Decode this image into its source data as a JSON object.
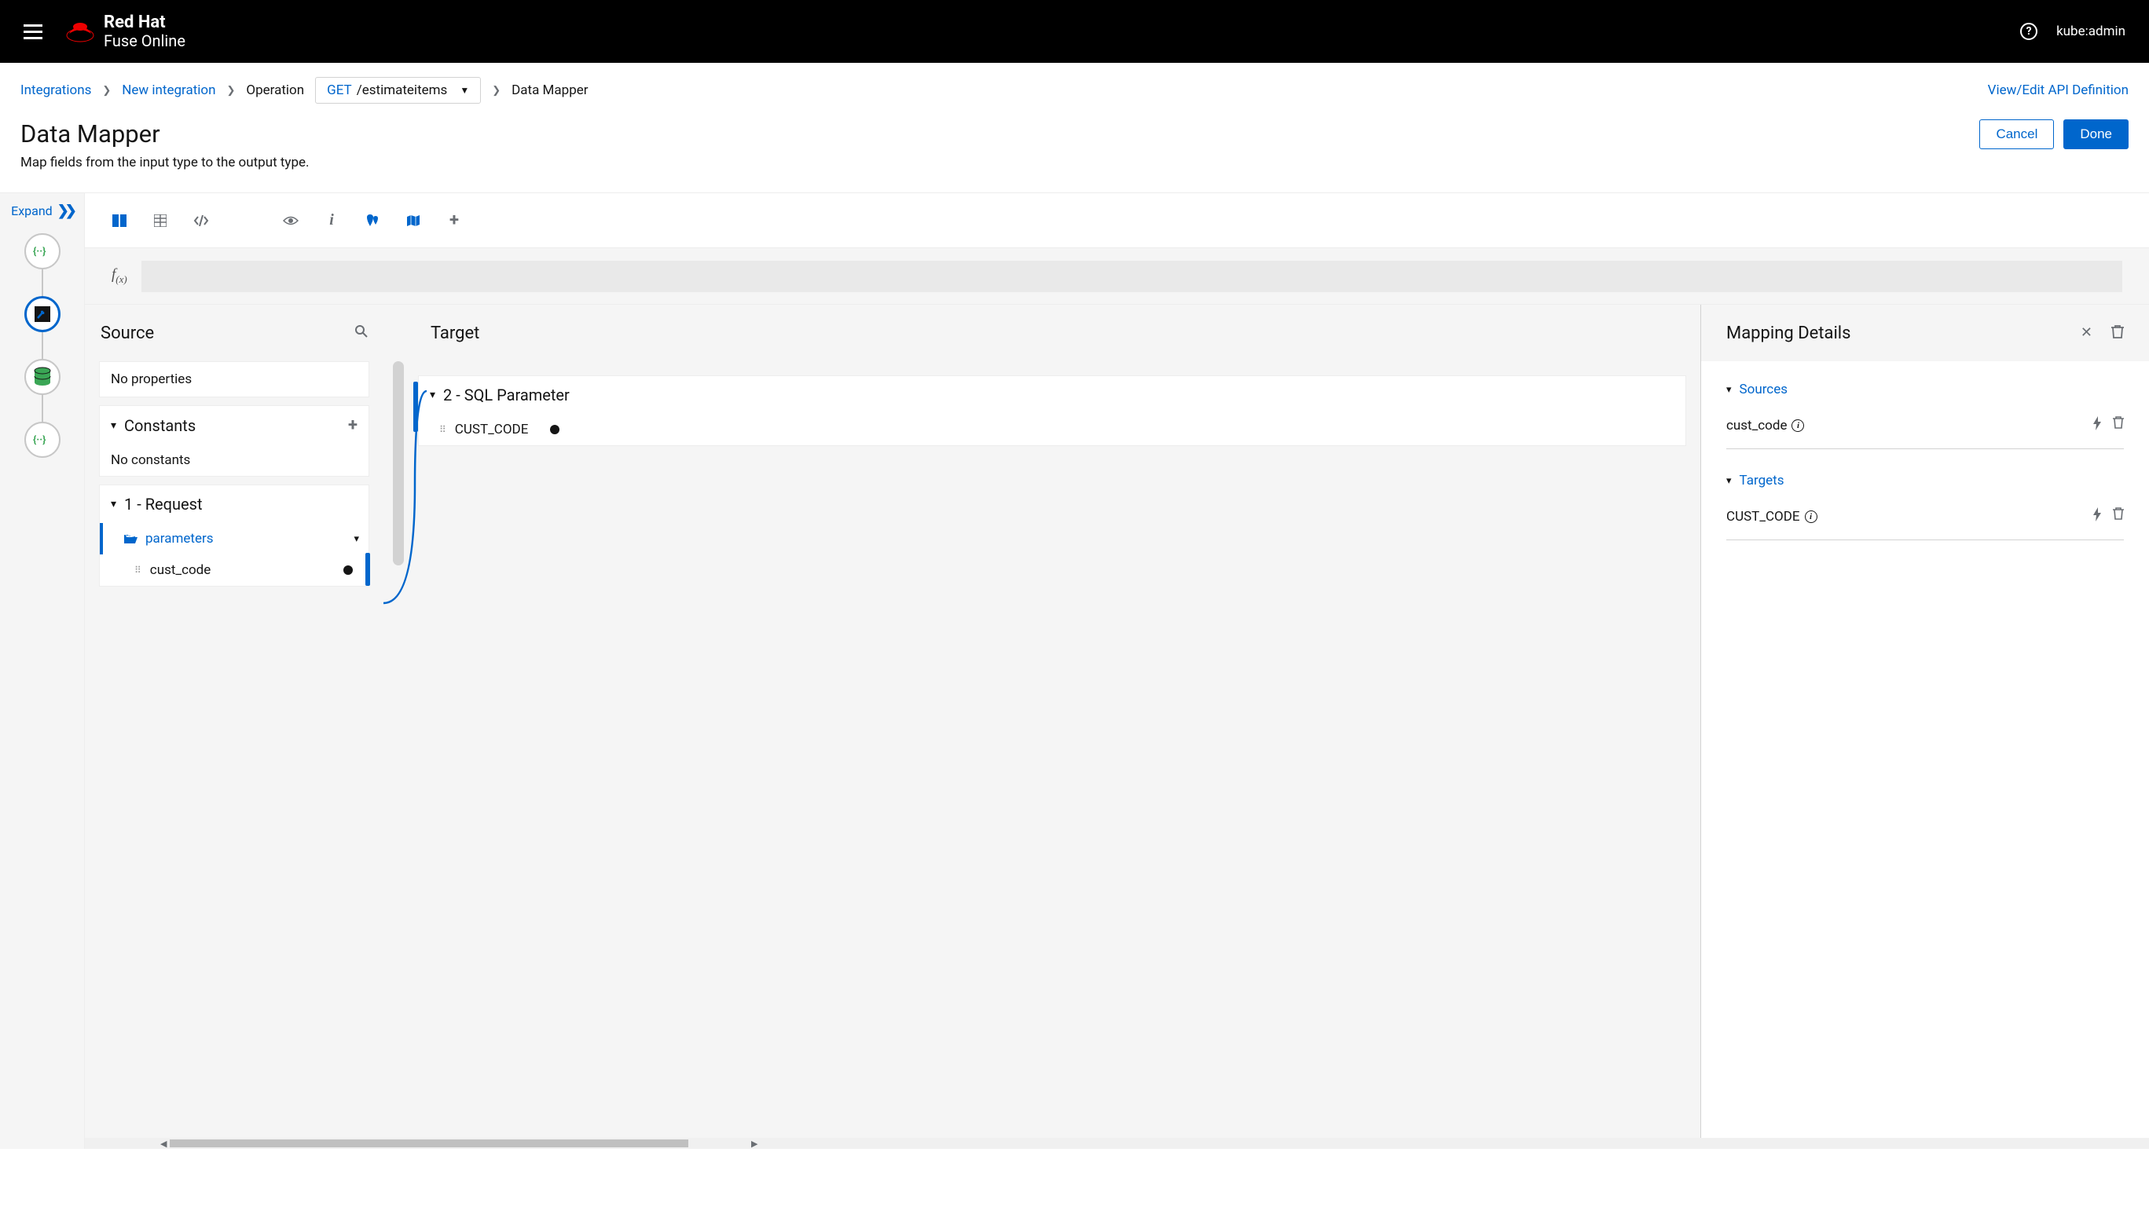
{
  "banner": {
    "brand_line1": "Red Hat",
    "brand_line2": "Fuse Online",
    "user": "kube:admin"
  },
  "crumbs": {
    "integrations": "Integrations",
    "new_integration": "New integration",
    "operation": "Operation",
    "method": "GET",
    "path": "/estimateitems",
    "current": "Data Mapper",
    "api_link": "View/Edit API Definition"
  },
  "title": {
    "heading": "Data Mapper",
    "subtitle": "Map fields from the input type to the output type.",
    "cancel": "Cancel",
    "done": "Done"
  },
  "strip": {
    "expand": "Expand"
  },
  "fx": {
    "label_f": "f",
    "label_x": "(x)"
  },
  "cols": {
    "source_title": "Source",
    "target_title": "Target",
    "details_title": "Mapping Details"
  },
  "source": {
    "no_properties": "No properties",
    "constants_header": "Constants",
    "no_constants": "No constants",
    "request_header": "1 - Request",
    "parameters_label": "parameters",
    "cust_code_label": "cust_code"
  },
  "target": {
    "sql_param_header": "2 - SQL Parameter",
    "cust_code_upper": "CUST_CODE"
  },
  "details": {
    "sources_header": "Sources",
    "targets_header": "Targets",
    "source_field": "cust_code",
    "target_field": "CUST_CODE"
  }
}
